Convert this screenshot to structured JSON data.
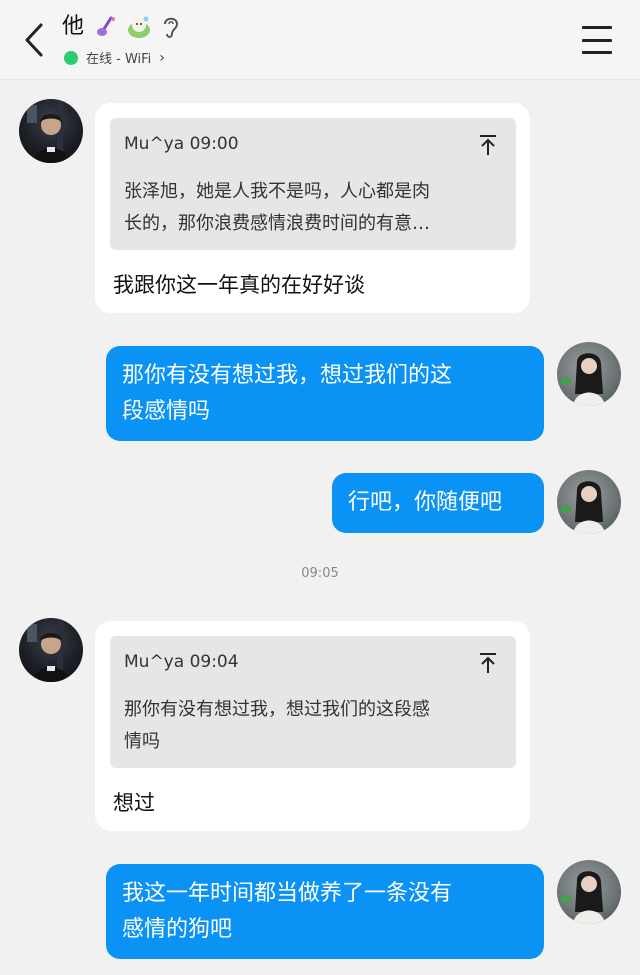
{
  "header": {
    "back_icon": "chevron-left-icon",
    "contact_name": "他",
    "emojis": [
      "guitar-emoji",
      "chick-emoji",
      "ear-emoji"
    ],
    "status_text": "在线 - WiFi",
    "status_color": "#2ecc71",
    "menu_icon": "hamburger-menu-icon"
  },
  "messages": [
    {
      "side": "left",
      "quote": {
        "meta": "Mu^ya 09:00",
        "text_line1": "张泽旭，她是人我不是吗，人心都是肉",
        "text_line2": "长的，那你浪费感情浪费时间的有意…"
      },
      "text": "我跟你这一年真的在好好谈"
    },
    {
      "side": "right",
      "line1": "那你有没有想过我，想过我们的这",
      "line2": "段感情吗"
    },
    {
      "side": "right",
      "line1": "行吧，你随便吧"
    },
    {
      "side": "left",
      "quote": {
        "meta": "Mu^ya 09:04",
        "text_line1": "那你有没有想过我，想过我们的这段感",
        "text_line2": "情吗"
      },
      "text": "想过"
    },
    {
      "side": "right",
      "line1": "我这一年时间都当做养了一条没有",
      "line2": "感情的狗吧"
    }
  ],
  "timestamp": "09:05",
  "colors": {
    "bubble_blue": "#0a93f5",
    "bubble_white": "#ffffff",
    "quote_bg": "#e6e6e6",
    "background": "#f1f1f1"
  }
}
